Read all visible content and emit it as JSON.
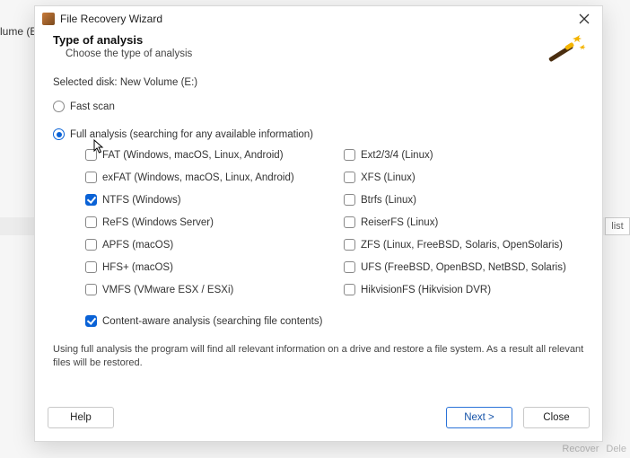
{
  "bg": {
    "volume_label": "lume (E:",
    "list_btn": "list",
    "recover_btn": "Recover",
    "delete_btn": "Dele"
  },
  "titlebar": {
    "title": "File Recovery Wizard"
  },
  "header": {
    "title": "Type of analysis",
    "subtitle": "Choose the type of analysis"
  },
  "selected_disk": {
    "label": "Selected disk:",
    "value": "New Volume (E:)"
  },
  "scan": {
    "fast": {
      "label": "Fast scan",
      "selected": false
    },
    "full": {
      "label": "Full analysis (searching for any available information)",
      "selected": true
    }
  },
  "filesystems": {
    "left": [
      {
        "name": "fat",
        "label": "FAT (Windows, macOS, Linux, Android)",
        "checked": false
      },
      {
        "name": "exfat",
        "label": "exFAT (Windows, macOS, Linux, Android)",
        "checked": false
      },
      {
        "name": "ntfs",
        "label": "NTFS (Windows)",
        "checked": true
      },
      {
        "name": "refs",
        "label": "ReFS (Windows Server)",
        "checked": false
      },
      {
        "name": "apfs",
        "label": "APFS (macOS)",
        "checked": false
      },
      {
        "name": "hfs",
        "label": "HFS+ (macOS)",
        "checked": false
      },
      {
        "name": "vmfs",
        "label": "VMFS (VMware ESX / ESXi)",
        "checked": false
      }
    ],
    "right": [
      {
        "name": "ext",
        "label": "Ext2/3/4 (Linux)",
        "checked": false
      },
      {
        "name": "xfs",
        "label": "XFS (Linux)",
        "checked": false
      },
      {
        "name": "btrfs",
        "label": "Btrfs (Linux)",
        "checked": false
      },
      {
        "name": "reiserfs",
        "label": "ReiserFS (Linux)",
        "checked": false
      },
      {
        "name": "zfs",
        "label": "ZFS (Linux, FreeBSD, Solaris, OpenSolaris)",
        "checked": false
      },
      {
        "name": "ufs",
        "label": "UFS (FreeBSD, OpenBSD, NetBSD, Solaris)",
        "checked": false
      },
      {
        "name": "hikfs",
        "label": "HikvisionFS (Hikvision DVR)",
        "checked": false
      }
    ]
  },
  "content_aware": {
    "label": "Content-aware analysis (searching file contents)",
    "checked": true
  },
  "description": "Using full analysis the program will find all relevant information on a drive and restore a file system. As a result all relevant files will be restored.",
  "buttons": {
    "help": "Help",
    "next": "Next >",
    "close": "Close"
  }
}
